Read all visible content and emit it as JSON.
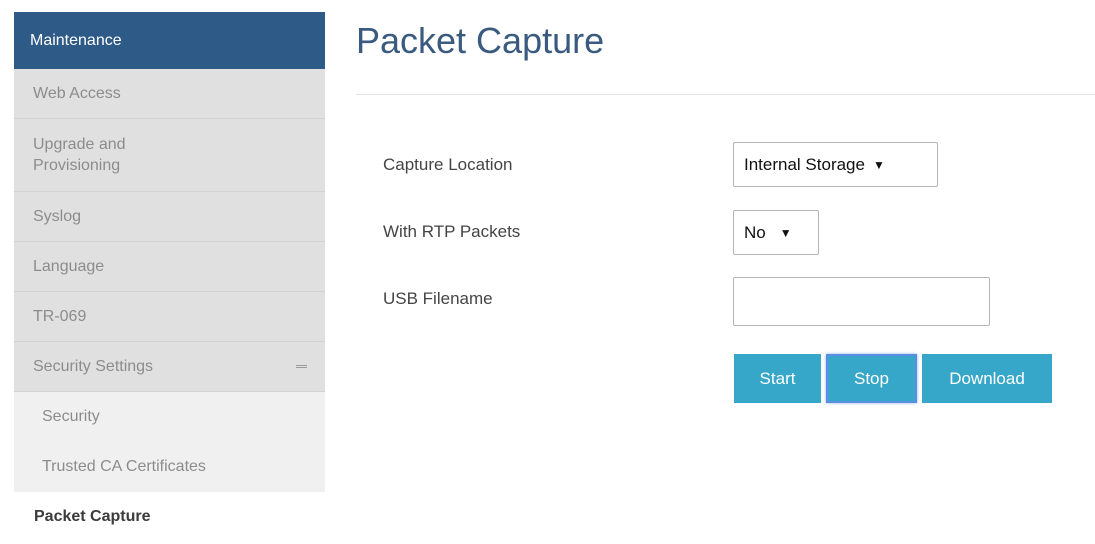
{
  "sidebar": {
    "header": "Maintenance",
    "items": [
      {
        "label": "Web Access"
      },
      {
        "label": "Upgrade and Provisioning"
      },
      {
        "label": "Syslog"
      },
      {
        "label": "Language"
      },
      {
        "label": "TR-069"
      },
      {
        "label": "Security Settings"
      }
    ],
    "sub_items": [
      {
        "label": "Security"
      },
      {
        "label": "Trusted CA Certificates"
      }
    ],
    "active_item": "Packet Capture"
  },
  "main": {
    "title": "Packet Capture",
    "fields": {
      "capture_location": {
        "label": "Capture Location",
        "value": "Internal Storage"
      },
      "with_rtp": {
        "label": "With RTP Packets",
        "value": "No"
      },
      "usb_filename": {
        "label": "USB Filename",
        "value": ""
      }
    },
    "buttons": {
      "start": "Start",
      "stop": "Stop",
      "download": "Download"
    }
  },
  "colors": {
    "sidebar_header": "#2e5a87",
    "title": "#3a5a80",
    "button": "#36a6c9"
  },
  "icons": {
    "collapse": "minus-icon",
    "dropdown": "dropdown-arrow-icon"
  }
}
